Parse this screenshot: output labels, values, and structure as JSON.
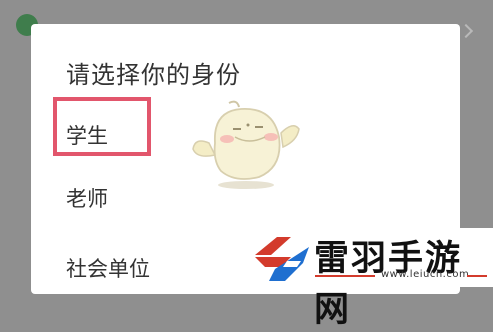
{
  "dialog": {
    "title": "请选择你的身份",
    "options": [
      {
        "label": "学生"
      },
      {
        "label": "老师"
      },
      {
        "label": "社会单位"
      }
    ],
    "highlighted_option": "学生"
  },
  "watermark": {
    "brand": "雷羽手游网",
    "url": "www.leiucn.com"
  },
  "colors": {
    "highlight": "#e2566c",
    "backdrop": "#8f8f8f",
    "brand_red": "#d33b2c",
    "brand_blue": "#1f6fd0"
  },
  "icons": {
    "mascot": "cartoon-chick-mascot",
    "brand_logo": "leiyu-logo-icon"
  }
}
